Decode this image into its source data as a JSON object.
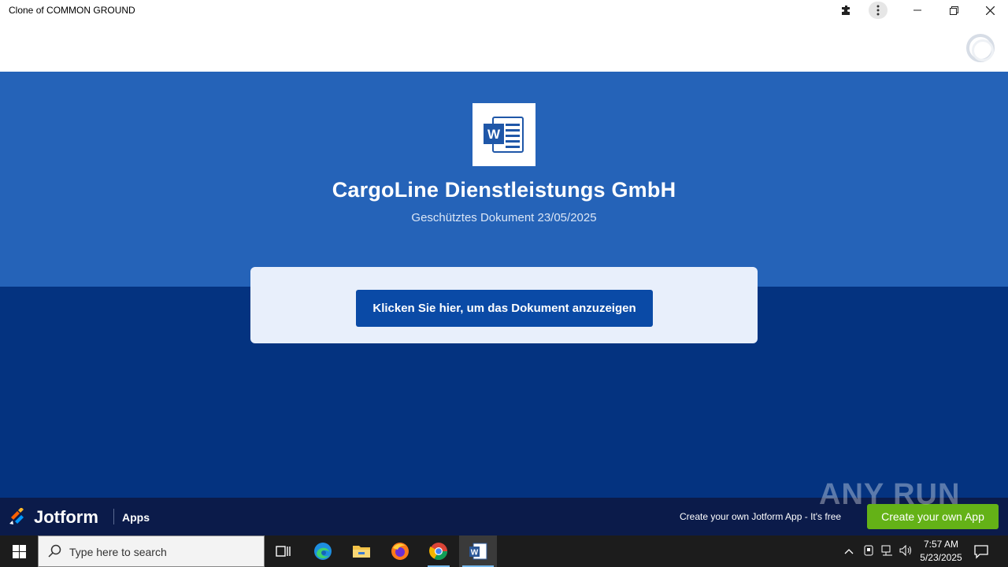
{
  "window": {
    "title": "Clone of COMMON GROUND"
  },
  "document": {
    "icon": "word-doc-icon",
    "company": "CargoLine Dienstleistungs GmbH",
    "subtitle": "Geschütztes Dokument 23/05/2025",
    "cta_label": "Klicken Sie hier, um das Dokument anzuzeigen"
  },
  "jotform": {
    "brand": "Jotform",
    "apps_label": "Apps",
    "promo_text": "Create your own Jotform App - It's free",
    "create_label": "Create your own App"
  },
  "watermark": "ANY RUN",
  "taskbar": {
    "search_placeholder": "Type here to search",
    "time": "7:57 AM",
    "date": "5/23/2025"
  },
  "colors": {
    "hero": "#2563b8",
    "lower": "#043380",
    "cta": "#0a4aa6",
    "jotbar": "#0b1b4a",
    "create": "#64b217"
  }
}
